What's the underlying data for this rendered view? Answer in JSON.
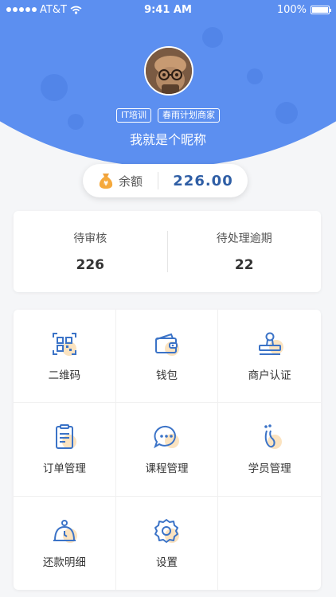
{
  "status_bar": {
    "carrier": "AT&T",
    "time": "9:41 AM",
    "battery": "100%"
  },
  "profile": {
    "tags": [
      "IT培训",
      "春雨计划商家"
    ],
    "nickname": "我就是个昵称"
  },
  "balance": {
    "label": "余额",
    "value": "226.00",
    "icon": "money-bag-icon"
  },
  "stats": [
    {
      "label": "待审核",
      "value": "226"
    },
    {
      "label": "待处理逾期",
      "value": "22"
    }
  ],
  "menu": [
    {
      "label": "二维码",
      "icon": "qr-code-icon"
    },
    {
      "label": "钱包",
      "icon": "wallet-icon"
    },
    {
      "label": "商户认证",
      "icon": "stamp-icon"
    },
    {
      "label": "订单管理",
      "icon": "order-document-icon"
    },
    {
      "label": "课程管理",
      "icon": "chat-bubble-icon"
    },
    {
      "label": "学员管理",
      "icon": "footprint-icon"
    },
    {
      "label": "还款明细",
      "icon": "timer-icon"
    },
    {
      "label": "设置",
      "icon": "settings-gear-icon"
    }
  ],
  "colors": {
    "primary": "#5c8ff0",
    "accent_blue": "#2f5ea5",
    "icon_accent": "#f7c98a"
  }
}
